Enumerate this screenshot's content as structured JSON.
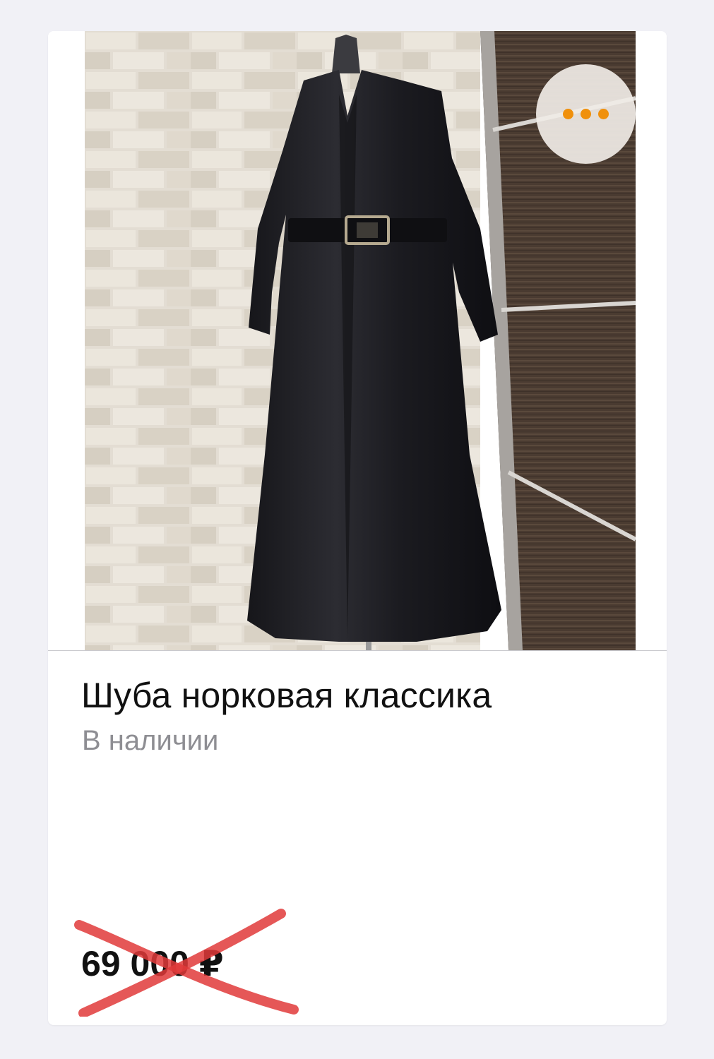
{
  "product": {
    "title": "Шуба норковая классика",
    "availability": "В наличии",
    "price": "69 000 ₽",
    "price_struck": true
  },
  "more_button": {
    "icon": "more-horizontal-icon",
    "dot_color": "#f0900c"
  },
  "colors": {
    "strike": "#e03a3a",
    "background": "#f1f1f6",
    "card": "#ffffff"
  }
}
